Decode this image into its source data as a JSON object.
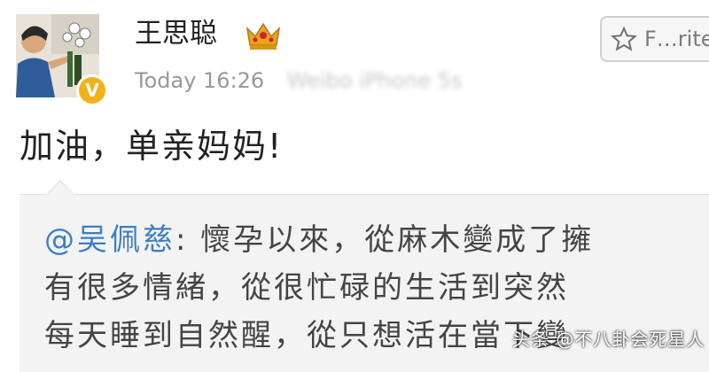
{
  "post": {
    "username": "王思聪",
    "timestamp": "Today 16:26",
    "source_text": "Weibo iPhone 5s",
    "text": "加油，单亲妈妈!",
    "favorite_label": "F…rite"
  },
  "quoted": {
    "mention": "@吴佩慈",
    "separator": ": ",
    "lines": [
      "懷孕以來，從麻木變成了擁",
      "有很多情緒，從很忙碌的生活到突然",
      "每天睡到自然醒，從只想活在當下變"
    ]
  },
  "watermark": "头条 @不八卦会死星人",
  "badge": {
    "verified_letter": "V"
  },
  "colors": {
    "verified": "#f2b21b",
    "mention": "#3f7fbf",
    "crown": "#e8a51a"
  },
  "icons": [
    "crown-icon",
    "star-icon",
    "verified-icon"
  ]
}
